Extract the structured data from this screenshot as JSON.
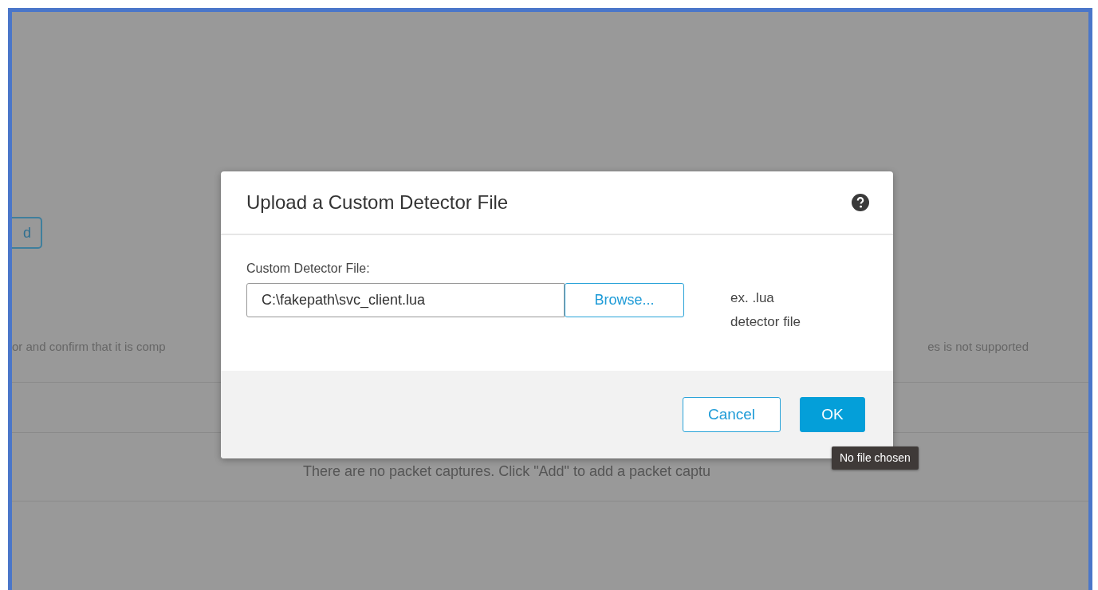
{
  "background": {
    "button_label": "d",
    "notice_left": "or and confirm that it is comp",
    "notice_right": "es is not supported",
    "empty_message": "There are no packet captures. Click \"Add\" to add a packet captu"
  },
  "dialog": {
    "title": "Upload a Custom Detector File",
    "field_label": "Custom Detector File:",
    "field_value": "C:\\fakepath\\svc_client.lua",
    "browse_label": "Browse...",
    "hint_lines": [
      "ex. .lua",
      "detector file"
    ],
    "buttons": [
      {
        "label": "Cancel",
        "kind": "secondary"
      },
      {
        "label": "OK",
        "kind": "primary"
      }
    ]
  },
  "tooltip": "No file chosen"
}
